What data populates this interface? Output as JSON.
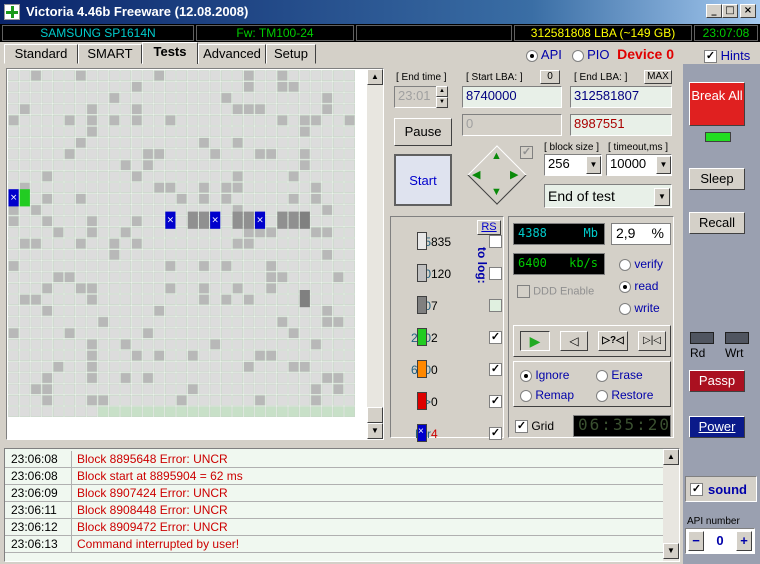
{
  "window": {
    "title": "Victoria 4.46b Freeware (12.08.2008)",
    "minimize": "_",
    "maximize": "□",
    "close": "×"
  },
  "info": {
    "model": "SAMSUNG SP1614N",
    "firmware": "Fw: TM100-24",
    "capacity": "312581808 LBA (~149 GB)",
    "clock": "23:07:08"
  },
  "tabs": [
    "Standard",
    "SMART",
    "Tests",
    "Advanced",
    "Setup"
  ],
  "mode": {
    "api": "API",
    "pio": "PIO",
    "device": "Device 0",
    "hints": "Hints"
  },
  "params": {
    "end_time_label": "[ End time ]",
    "end_time_value": "23:01",
    "start_lba_label": "[ Start LBA: ]",
    "start_lba_zero": "0",
    "start_lba_value": "8740000",
    "end_lba_label": "[ End LBA: ]",
    "end_lba_max": "MAX",
    "end_lba_value": "312581807",
    "current_value": "0",
    "current_lba": "8987551",
    "block_size_label": "[ block size ]",
    "block_size_value": "256",
    "timeout_label": "[ timeout,ms ]",
    "timeout_value": "10000",
    "end_action": "End of test",
    "pause": "Pause",
    "start": "Start"
  },
  "legend": {
    "rs": "RS",
    "to_log": "to log:",
    "rows": [
      {
        "label": "5",
        "count": "835",
        "color": "#e8e8e8"
      },
      {
        "label": "20",
        "count": "120",
        "color": "#c0c0c0"
      },
      {
        "label": "50",
        "count": "7",
        "color": "#808080"
      },
      {
        "label": "200",
        "count": "2",
        "color": "#22cc22"
      },
      {
        "label": "600",
        "count": "0",
        "color": "#ff8800"
      },
      {
        "label": ">",
        "count": "0",
        "color": "#dd0000"
      },
      {
        "label": "Err",
        "count": "4",
        "color": "#0000cc"
      }
    ]
  },
  "stats": {
    "mb_value": "4388",
    "mb_unit": "Mb",
    "percent_value": "2,9",
    "percent_unit": "%",
    "speed_value": "6400",
    "speed_unit": "kb/s",
    "verify": "verify",
    "read": "read",
    "write": "write",
    "ddd": "DDD Enable",
    "ignore": "Ignore",
    "erase": "Erase",
    "remap": "Remap",
    "restore": "Restore",
    "grid": "Grid",
    "timer": "06:35:20"
  },
  "side": {
    "break_all": "Break All",
    "sleep": "Sleep",
    "recall": "Recall",
    "rd": "Rd",
    "wrt": "Wrt",
    "passp": "Passp",
    "power": "Power",
    "sound": "sound",
    "api_number_label": "API number",
    "api_number": "0",
    "minus": "−",
    "plus": "+"
  },
  "log": [
    {
      "time": "23:06:08",
      "msg": "Block 8895648 Error: UNCR"
    },
    {
      "time": "23:06:08",
      "msg": "Block start at 8895904 = 62 ms"
    },
    {
      "time": "23:06:09",
      "msg": "Block 8907424 Error: UNCR"
    },
    {
      "time": "23:06:11",
      "msg": "Block 8908448 Error: UNCR"
    },
    {
      "time": "23:06:12",
      "msg": "Block 8909472 Error: UNCR"
    },
    {
      "time": "23:06:13",
      "msg": "Command interrupted by user!"
    }
  ]
}
